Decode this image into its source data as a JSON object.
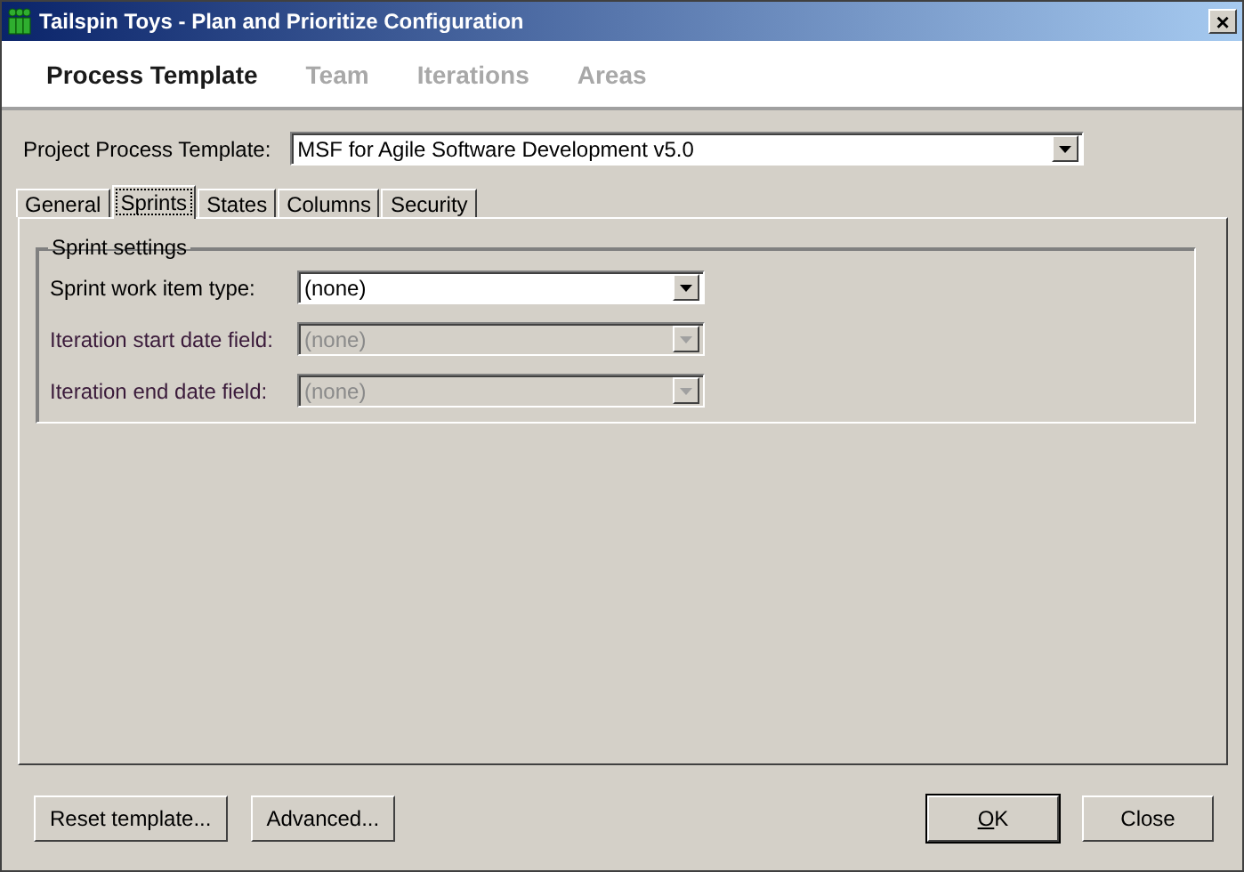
{
  "window": {
    "title": "Tailspin Toys - Plan and Prioritize Configuration",
    "close": "×"
  },
  "nav": [
    {
      "label": "Process Template",
      "selected": true
    },
    {
      "label": "Team",
      "selected": false
    },
    {
      "label": "Iterations",
      "selected": false
    },
    {
      "label": "Areas",
      "selected": false
    }
  ],
  "template": {
    "label": "Project Process Template:",
    "value": "MSF for Agile Software Development v5.0"
  },
  "tabs": [
    {
      "label": "General",
      "selected": false
    },
    {
      "label": "Sprints",
      "selected": true
    },
    {
      "label": "States",
      "selected": false
    },
    {
      "label": "Columns",
      "selected": false
    },
    {
      "label": "Security",
      "selected": false
    }
  ],
  "sprint_settings": {
    "title": "Sprint settings",
    "fields": [
      {
        "label": "Sprint work item type:",
        "value": "(none)",
        "disabled": false
      },
      {
        "label": "Iteration start date field:",
        "value": "(none)",
        "disabled": true
      },
      {
        "label": "Iteration end date field:",
        "value": "(none)",
        "disabled": true
      }
    ]
  },
  "buttons_left": [
    "Reset template...",
    "Advanced..."
  ],
  "buttons_right": [
    {
      "label": "OK",
      "kind": "default"
    },
    {
      "label": "Close",
      "kind": "normal"
    }
  ]
}
